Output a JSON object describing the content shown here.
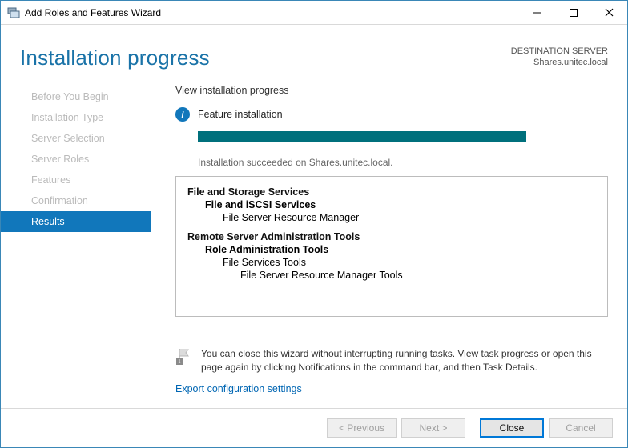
{
  "window": {
    "title": "Add Roles and Features Wizard"
  },
  "header": {
    "page_title": "Installation progress",
    "dest_label": "DESTINATION SERVER",
    "dest_server": "Shares.unitec.local"
  },
  "sidebar": {
    "steps": [
      "Before You Begin",
      "Installation Type",
      "Server Selection",
      "Server Roles",
      "Features",
      "Confirmation",
      "Results"
    ],
    "active_index": 6
  },
  "main": {
    "section_label": "View installation progress",
    "feature_label": "Feature installation",
    "status_text": "Installation succeeded on Shares.unitec.local.",
    "tree": {
      "group1": {
        "root": "File and Storage Services",
        "l1": "File and iSCSI Services",
        "l2": "File Server Resource Manager"
      },
      "group2": {
        "root": "Remote Server Administration Tools",
        "l1": "Role Administration Tools",
        "l2": "File Services Tools",
        "l3": "File Server Resource Manager Tools"
      }
    },
    "note_text": "You can close this wizard without interrupting running tasks. View task progress or open this page again by clicking Notifications in the command bar, and then Task Details.",
    "export_link": "Export configuration settings"
  },
  "footer": {
    "previous": "< Previous",
    "next": "Next >",
    "close": "Close",
    "cancel": "Cancel"
  }
}
